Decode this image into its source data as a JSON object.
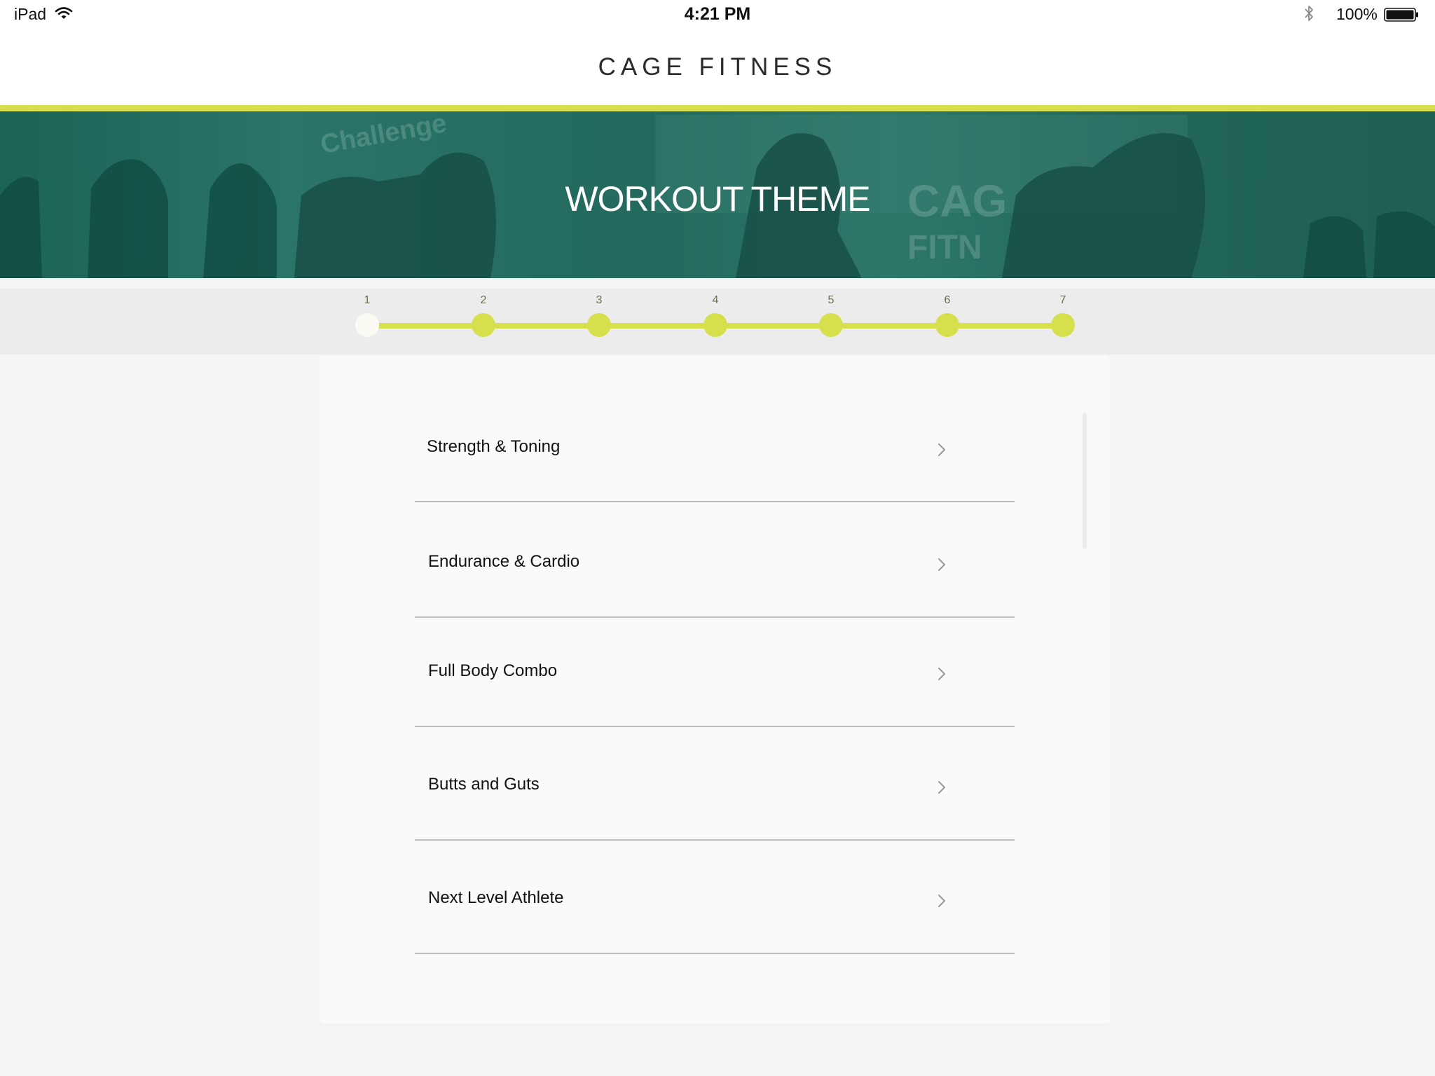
{
  "status_bar": {
    "device": "iPad",
    "time": "4:21 PM",
    "battery": "100%"
  },
  "header": {
    "brand": "CAGE FITNESS"
  },
  "hero": {
    "title": "WORKOUT THEME"
  },
  "progress": {
    "steps": [
      "1",
      "2",
      "3",
      "4",
      "5",
      "6",
      "7"
    ],
    "current_step": 1
  },
  "themes": [
    {
      "label": "Strength & Toning"
    },
    {
      "label": "Endurance & Cardio"
    },
    {
      "label": "Full Body Combo"
    },
    {
      "label": "Butts and Guts"
    },
    {
      "label": "Next Level Athlete"
    }
  ],
  "icons": {
    "wifi": "wifi-icon",
    "bluetooth": "bluetooth-icon",
    "battery": "battery-icon",
    "row_disclosure": "chevron-right-icon"
  },
  "colors": {
    "accent": "#d6df4c",
    "hero_tint": "#226659",
    "current_step": "#fbfbf4"
  }
}
